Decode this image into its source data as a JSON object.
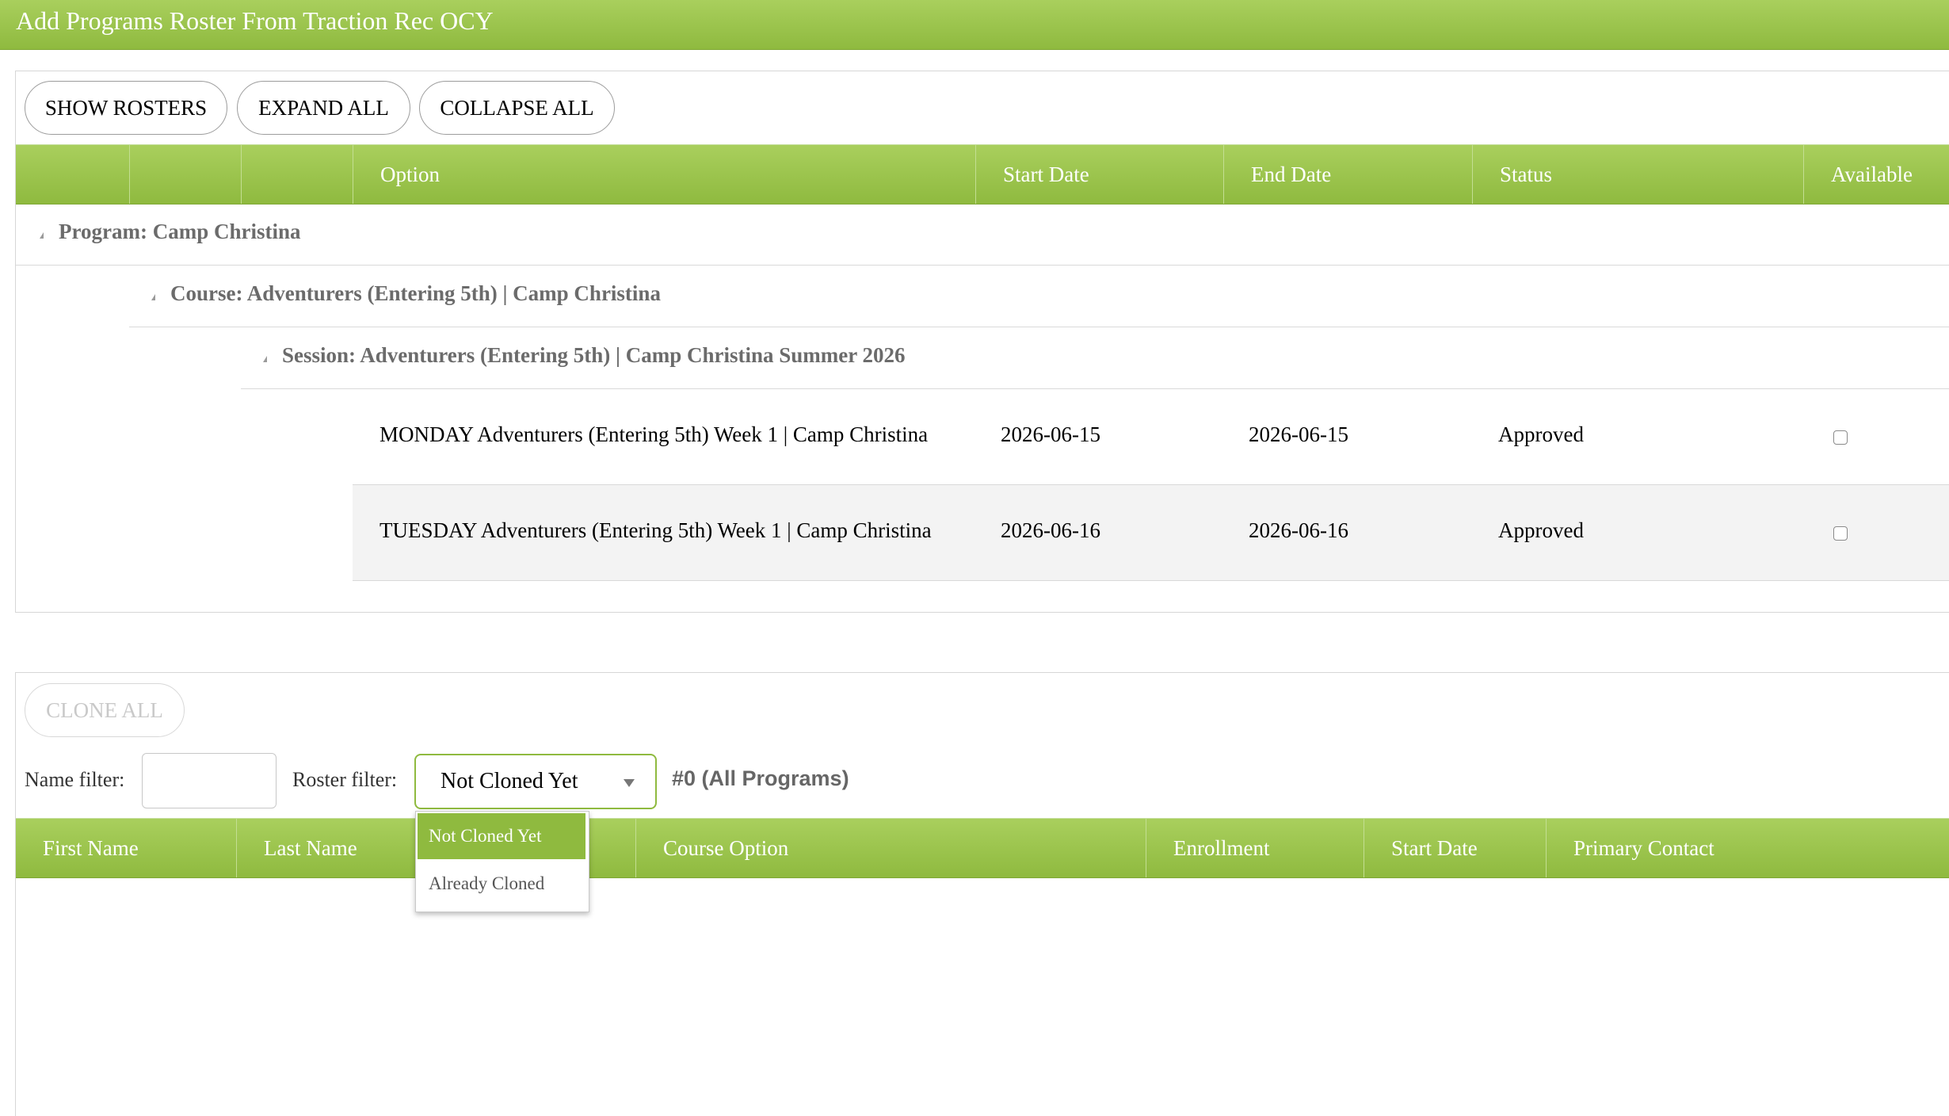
{
  "window": {
    "title": "Add Programs Roster From Traction Rec OCY"
  },
  "toolbar": {
    "show_rosters": "SHOW ROSTERS",
    "expand_all": "EXPAND ALL",
    "collapse_all": "COLLAPSE ALL"
  },
  "program_grid": {
    "columns": {
      "option": "Option",
      "start_date": "Start Date",
      "end_date": "End Date",
      "status": "Status",
      "available": "Available"
    },
    "program": "Program: Camp Christina",
    "course": "Course: Adventurers (Entering 5th) | Camp Christina",
    "session": "Session: Adventurers (Entering 5th) | Camp Christina Summer 2026",
    "rows": [
      {
        "option": "MONDAY Adventurers (Entering 5th) Week 1 | Camp Christina",
        "start_date": "2026-06-15",
        "end_date": "2026-06-15",
        "status": "Approved",
        "available": false
      },
      {
        "option": "TUESDAY Adventurers (Entering 5th) Week 1 | Camp Christina",
        "start_date": "2026-06-16",
        "end_date": "2026-06-16",
        "status": "Approved",
        "available": false
      }
    ]
  },
  "roster": {
    "clone_all": "CLONE ALL",
    "name_filter_label": "Name filter:",
    "name_filter_value": "",
    "roster_filter_label": "Roster filter:",
    "roster_filter_value": "Not Cloned Yet",
    "roster_filter_options": [
      "Not Cloned Yet",
      "Already Cloned"
    ],
    "count_label": "#0 (All Programs)",
    "columns": {
      "first_name": "First Name",
      "last_name": "Last Name",
      "course_option": "Course Option",
      "enrollment": "Enrollment",
      "start_date": "Start Date",
      "primary_contact": "Primary Contact"
    }
  },
  "colors": {
    "header_green": "#8fba3f",
    "header_light": "#a9cf5d",
    "selected_option": "#8fba3f"
  }
}
